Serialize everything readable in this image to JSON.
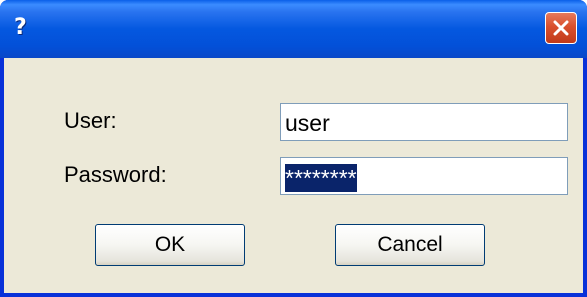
{
  "dialog": {
    "title": "?"
  },
  "form": {
    "user_label": "User:",
    "user_value": "user",
    "password_label": "Password:",
    "password_value": "********"
  },
  "buttons": {
    "ok_label": "OK",
    "cancel_label": "Cancel"
  },
  "colors": {
    "titlebar": "#0458e0",
    "close_button": "#d9502d",
    "dialog_background": "#ece9d8",
    "selection": "#0a246a"
  },
  "icons": {
    "close": "close-icon"
  }
}
